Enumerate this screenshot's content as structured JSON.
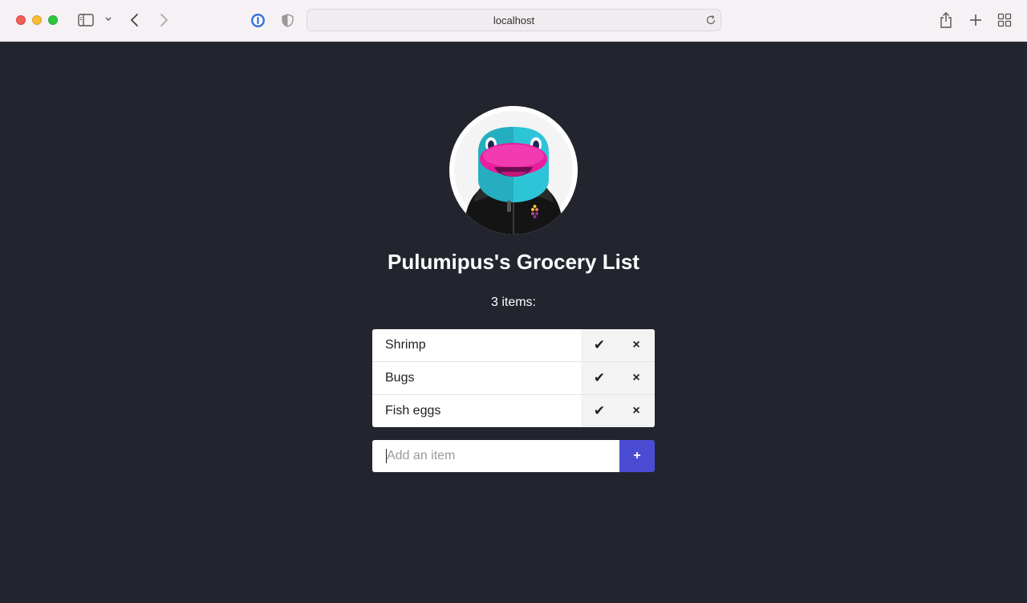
{
  "browser": {
    "url": "localhost",
    "colors": {
      "close": "#ee5f56",
      "minimize": "#f6bd34",
      "maximize": "#32c640"
    }
  },
  "page": {
    "avatar_icon": "platypus-mascot",
    "title": "Pulumipus's Grocery List",
    "item_count_text": "3 items:",
    "items": [
      {
        "label": "Shrimp",
        "check_label": "✔",
        "delete_label": "×"
      },
      {
        "label": "Bugs",
        "check_label": "✔",
        "delete_label": "×"
      },
      {
        "label": "Fish eggs",
        "check_label": "✔",
        "delete_label": "×"
      }
    ],
    "add_form": {
      "placeholder": "Add an item",
      "value": "",
      "button_label": "+"
    },
    "colors": {
      "background": "#22252d",
      "accent": "#4a4dd3"
    }
  }
}
